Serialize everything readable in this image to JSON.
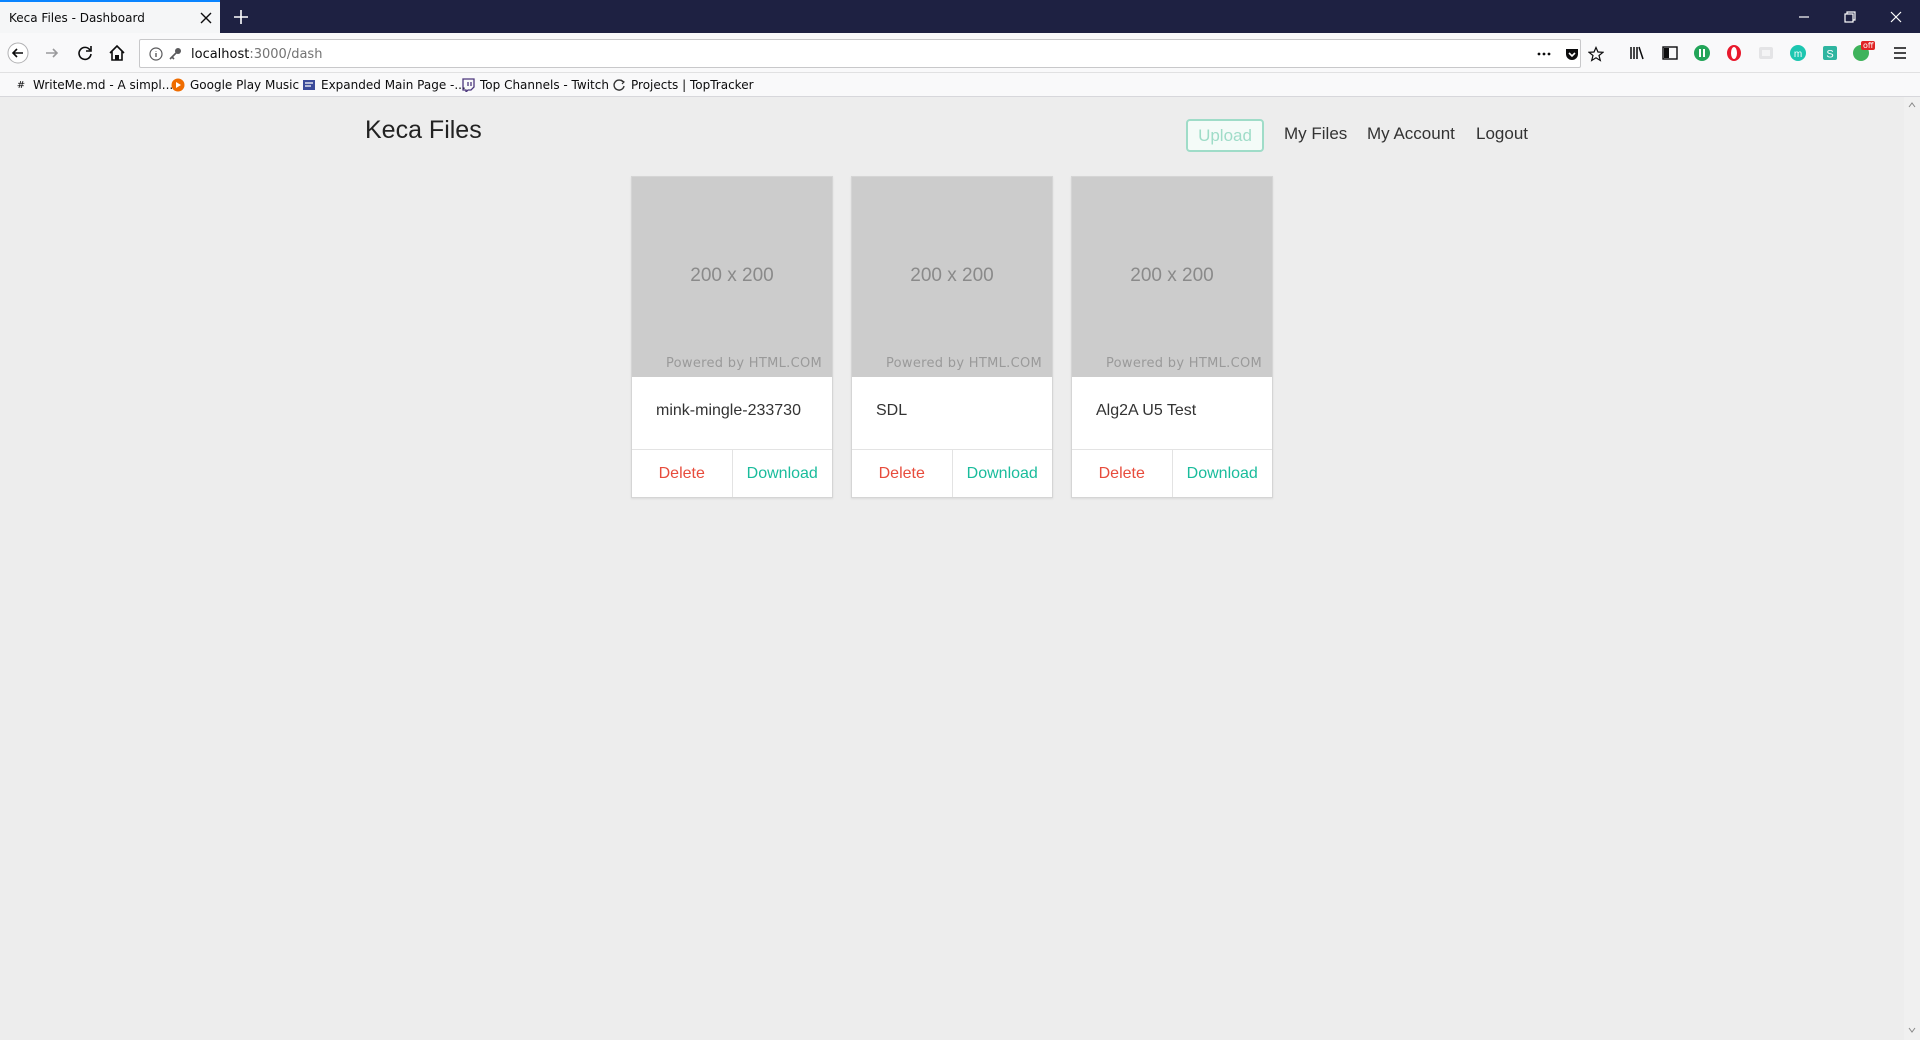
{
  "browser": {
    "tab_title": "Keca Files - Dashboard",
    "url_host": "localhost",
    "url_rest": ":3000/dash",
    "bookmarks": [
      {
        "label": "WriteMe.md - A simpl...",
        "icon": "hash-icon"
      },
      {
        "label": "Google Play Music",
        "icon": "play-music-icon"
      },
      {
        "label": "Expanded Main Page -...",
        "icon": "wiki-icon"
      },
      {
        "label": "Top Channels - Twitch",
        "icon": "twitch-icon"
      },
      {
        "label": "Projects | TopTracker",
        "icon": "toptracker-icon"
      }
    ],
    "ext_badge": "off"
  },
  "app": {
    "brand": "Keca Files",
    "nav": {
      "upload": "Upload",
      "my_files": "My Files",
      "my_account": "My Account",
      "logout": "Logout"
    },
    "colors": {
      "delete": "#e74c3c",
      "download": "#1abc9c",
      "upload_border": "#9fdcc8"
    },
    "files": [
      {
        "name": "mink-mingle-233730",
        "thumb_size": "200 x 200",
        "thumb_credit": "Powered by HTML.COM",
        "delete_label": "Delete",
        "download_label": "Download"
      },
      {
        "name": "SDL",
        "thumb_size": "200 x 200",
        "thumb_credit": "Powered by HTML.COM",
        "delete_label": "Delete",
        "download_label": "Download"
      },
      {
        "name": "Alg2A U5 Test",
        "thumb_size": "200 x 200",
        "thumb_credit": "Powered by HTML.COM",
        "delete_label": "Delete",
        "download_label": "Download"
      }
    ]
  }
}
